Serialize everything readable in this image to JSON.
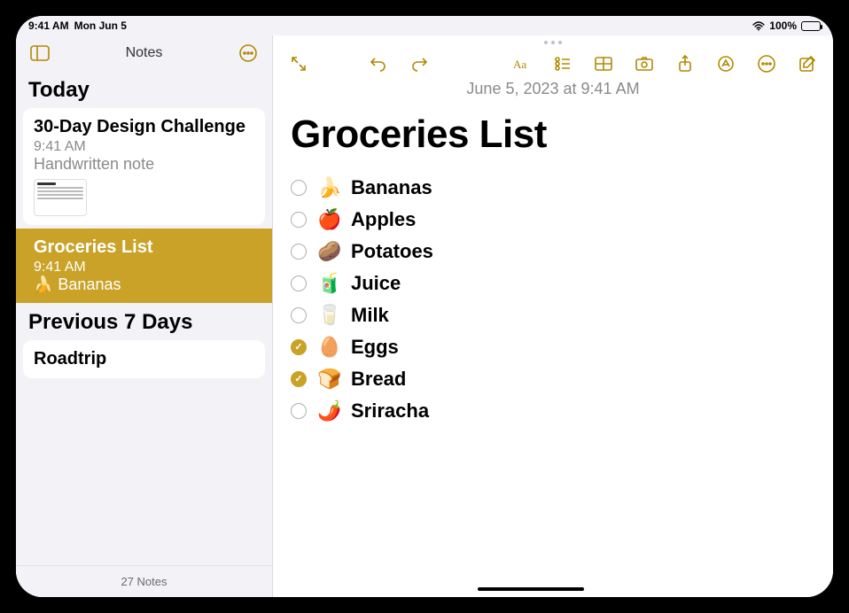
{
  "statusbar": {
    "time": "9:41 AM",
    "date": "Mon Jun 5",
    "battery_pct": "100%"
  },
  "sidebar": {
    "title": "Notes",
    "sections": [
      {
        "header": "Today",
        "notes": [
          {
            "title": "30-Day Design Challenge",
            "time": "9:41 AM",
            "subtitle": "Handwritten note",
            "selected": false,
            "has_thumb": true
          },
          {
            "title": "Groceries List",
            "time": "9:41 AM",
            "subtitle": "🍌 Bananas",
            "selected": true,
            "has_thumb": false
          }
        ]
      },
      {
        "header": "Previous 7 Days",
        "notes": [
          {
            "title": "Roadtrip",
            "time": "",
            "subtitle": "",
            "selected": false,
            "has_thumb": false
          }
        ]
      }
    ],
    "footer": "27 Notes"
  },
  "note": {
    "date": "June 5, 2023 at 9:41 AM",
    "title": "Groceries List",
    "items": [
      {
        "emoji": "🍌",
        "label": "Bananas",
        "checked": false
      },
      {
        "emoji": "🍎",
        "label": "Apples",
        "checked": false
      },
      {
        "emoji": "🥔",
        "label": "Potatoes",
        "checked": false
      },
      {
        "emoji": "🧃",
        "label": "Juice",
        "checked": false
      },
      {
        "emoji": "🥛",
        "label": "Milk",
        "checked": false
      },
      {
        "emoji": "🥚",
        "label": "Eggs",
        "checked": true
      },
      {
        "emoji": "🍞",
        "label": "Bread",
        "checked": true
      },
      {
        "emoji": "🌶️",
        "label": "Sriracha",
        "checked": false
      }
    ]
  },
  "icons": {
    "sidebar_toggle": "sidebar-toggle-icon",
    "more": "more-options-icon",
    "expand": "expand-icon",
    "undo": "undo-icon",
    "redo": "redo-icon",
    "text_format": "text-format-icon",
    "checklist": "checklist-icon",
    "table": "table-icon",
    "camera": "camera-icon",
    "share": "share-icon",
    "markup": "markup-icon",
    "ellipsis": "ellipsis-icon",
    "compose": "compose-icon"
  }
}
